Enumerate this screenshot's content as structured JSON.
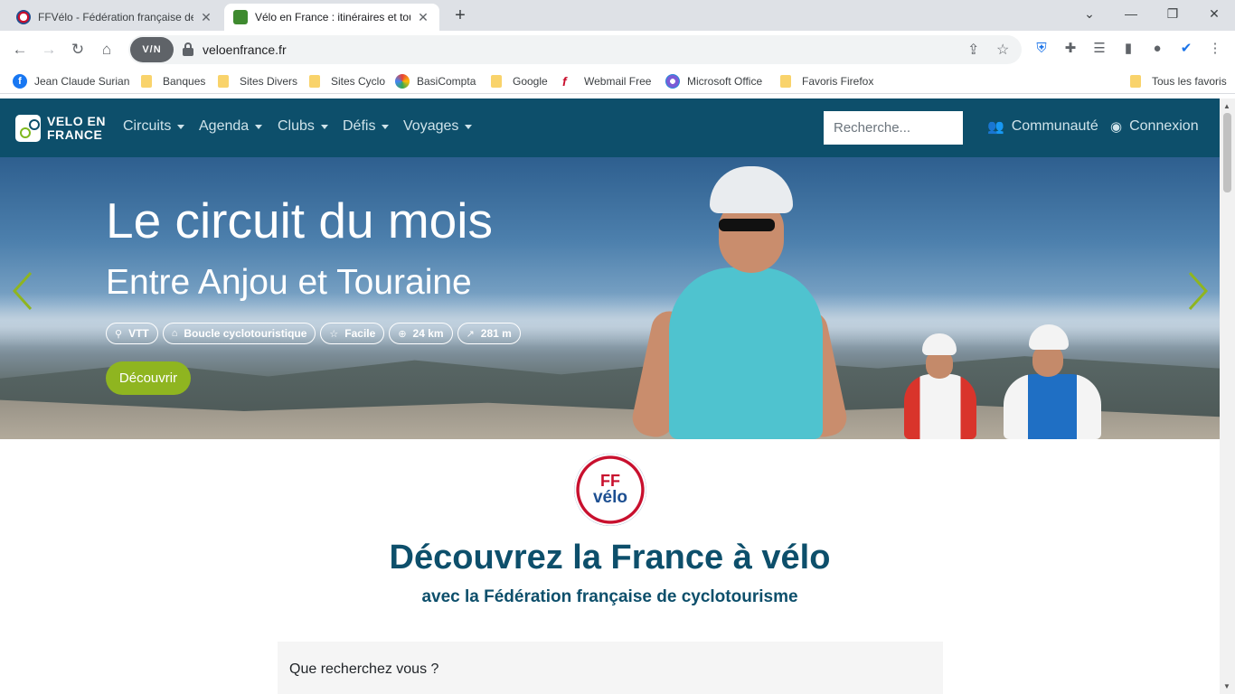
{
  "browser": {
    "tabs": [
      {
        "title": "FFVélo - Fédération française de"
      },
      {
        "title": "Vélo en France : itinéraires et tou"
      }
    ],
    "url": "veloenfrance.fr",
    "vpn_label": "V/N",
    "bookmarks": [
      "Jean Claude Surian",
      "Banques",
      "Sites Divers",
      "Sites Cyclo",
      "BasiCompta",
      "Google",
      "Webmail Free",
      "Microsoft Office",
      "Favoris Firefox",
      "Tous les favoris"
    ]
  },
  "site": {
    "logo_line1": "VELO EN",
    "logo_line2": "FRANCE",
    "nav": [
      "Circuits",
      "Agenda",
      "Clubs",
      "Défis",
      "Voyages"
    ],
    "search_placeholder": "Recherche...",
    "community": "Communauté",
    "login": "Connexion"
  },
  "hero": {
    "title": "Le circuit du mois",
    "subtitle": "Entre Anjou et Touraine",
    "badges": [
      {
        "icon": "bike-icon",
        "label": "VTT"
      },
      {
        "icon": "tag-icon",
        "label": "Boucle cyclotouristique"
      },
      {
        "icon": "star-icon",
        "label": "Facile"
      },
      {
        "icon": "distance-icon",
        "label": "24 km"
      },
      {
        "icon": "elevation-icon",
        "label": "281 m"
      }
    ],
    "cta": "Découvrir",
    "arrow_color": "#8fb520"
  },
  "content": {
    "logo_ff": "FF",
    "logo_velo": "vélo",
    "headline": "Découvrez la France à vélo",
    "subheadline": "avec la Fédération française de cyclotourisme",
    "search_question": "Que recherchez vous ?"
  },
  "colors": {
    "navbar": "#0d4f6b",
    "accent": "#8fb520",
    "heading": "#0d4f6b"
  }
}
